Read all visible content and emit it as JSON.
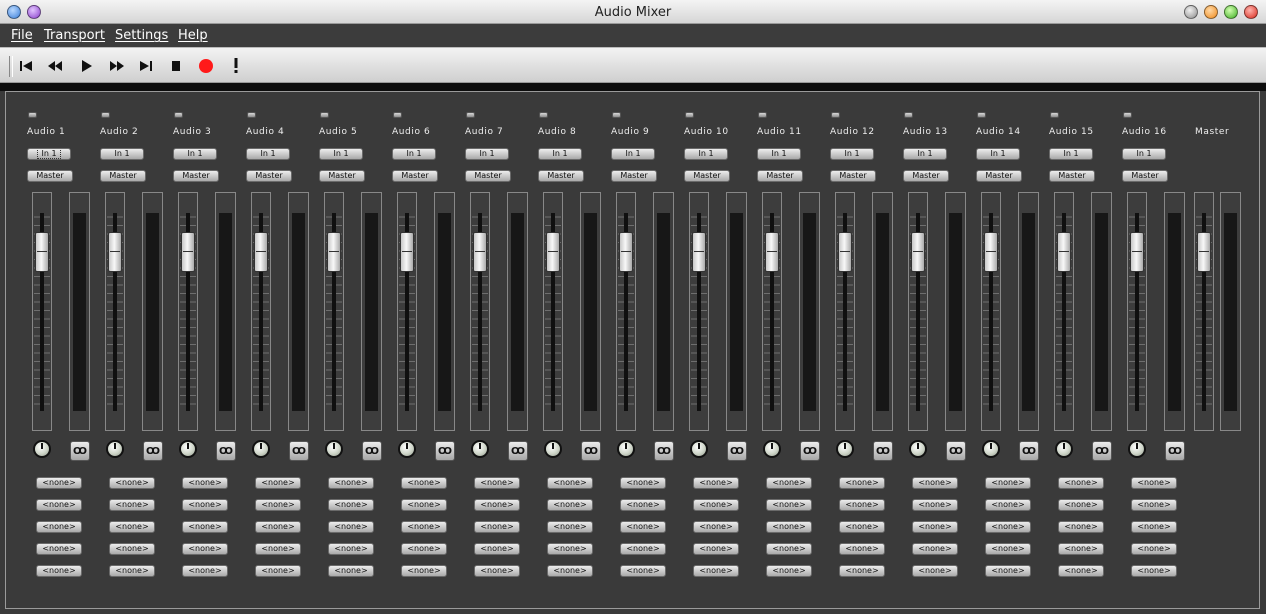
{
  "window": {
    "title": "Audio Mixer"
  },
  "menu": [
    "File",
    "Transport",
    "Settings",
    "Help"
  ],
  "toolbar": {
    "buttons": [
      {
        "name": "skip-to-start",
        "glyph": "⏮"
      },
      {
        "name": "rewind",
        "glyph": "⏪"
      },
      {
        "name": "play",
        "glyph": "▶"
      },
      {
        "name": "fast-forward",
        "glyph": "⏩"
      },
      {
        "name": "skip-to-end",
        "glyph": "⏭"
      },
      {
        "name": "stop",
        "glyph": "■"
      },
      {
        "name": "record",
        "glyph": "●"
      },
      {
        "name": "alert",
        "glyph": "!"
      }
    ],
    "record_color": "#ff1a1a"
  },
  "strips": [
    {
      "name": "Audio 1",
      "input": "In 1",
      "output": "Master",
      "fader_level": 0.87,
      "inserts": [
        "<none>",
        "<none>",
        "<none>",
        "<none>",
        "<none>"
      ]
    },
    {
      "name": "Audio 2",
      "input": "In 1",
      "output": "Master",
      "fader_level": 0.87,
      "inserts": [
        "<none>",
        "<none>",
        "<none>",
        "<none>",
        "<none>"
      ]
    },
    {
      "name": "Audio 3",
      "input": "In 1",
      "output": "Master",
      "fader_level": 0.87,
      "inserts": [
        "<none>",
        "<none>",
        "<none>",
        "<none>",
        "<none>"
      ]
    },
    {
      "name": "Audio 4",
      "input": "In 1",
      "output": "Master",
      "fader_level": 0.87,
      "inserts": [
        "<none>",
        "<none>",
        "<none>",
        "<none>",
        "<none>"
      ]
    },
    {
      "name": "Audio 5",
      "input": "In 1",
      "output": "Master",
      "fader_level": 0.87,
      "inserts": [
        "<none>",
        "<none>",
        "<none>",
        "<none>",
        "<none>"
      ]
    },
    {
      "name": "Audio 6",
      "input": "In 1",
      "output": "Master",
      "fader_level": 0.87,
      "inserts": [
        "<none>",
        "<none>",
        "<none>",
        "<none>",
        "<none>"
      ]
    },
    {
      "name": "Audio 7",
      "input": "In 1",
      "output": "Master",
      "fader_level": 0.87,
      "inserts": [
        "<none>",
        "<none>",
        "<none>",
        "<none>",
        "<none>"
      ]
    },
    {
      "name": "Audio 8",
      "input": "In 1",
      "output": "Master",
      "fader_level": 0.87,
      "inserts": [
        "<none>",
        "<none>",
        "<none>",
        "<none>",
        "<none>"
      ]
    },
    {
      "name": "Audio 9",
      "input": "In 1",
      "output": "Master",
      "fader_level": 0.87,
      "inserts": [
        "<none>",
        "<none>",
        "<none>",
        "<none>",
        "<none>"
      ]
    },
    {
      "name": "Audio 10",
      "input": "In 1",
      "output": "Master",
      "fader_level": 0.87,
      "inserts": [
        "<none>",
        "<none>",
        "<none>",
        "<none>",
        "<none>"
      ]
    },
    {
      "name": "Audio 11",
      "input": "In 1",
      "output": "Master",
      "fader_level": 0.87,
      "inserts": [
        "<none>",
        "<none>",
        "<none>",
        "<none>",
        "<none>"
      ]
    },
    {
      "name": "Audio 12",
      "input": "In 1",
      "output": "Master",
      "fader_level": 0.87,
      "inserts": [
        "<none>",
        "<none>",
        "<none>",
        "<none>",
        "<none>"
      ]
    },
    {
      "name": "Audio 13",
      "input": "In 1",
      "output": "Master",
      "fader_level": 0.87,
      "inserts": [
        "<none>",
        "<none>",
        "<none>",
        "<none>",
        "<none>"
      ]
    },
    {
      "name": "Audio 14",
      "input": "In 1",
      "output": "Master",
      "fader_level": 0.87,
      "inserts": [
        "<none>",
        "<none>",
        "<none>",
        "<none>",
        "<none>"
      ]
    },
    {
      "name": "Audio 15",
      "input": "In 1",
      "output": "Master",
      "fader_level": 0.87,
      "inserts": [
        "<none>",
        "<none>",
        "<none>",
        "<none>",
        "<none>"
      ]
    },
    {
      "name": "Audio 16",
      "input": "In 1",
      "output": "Master",
      "fader_level": 0.87,
      "inserts": [
        "<none>",
        "<none>",
        "<none>",
        "<none>",
        "<none>"
      ]
    }
  ],
  "master": {
    "name": "Master",
    "fader_level": 0.87
  },
  "icons": {
    "pan": "pan-knob-icon",
    "link": "stereo-link-icon"
  }
}
